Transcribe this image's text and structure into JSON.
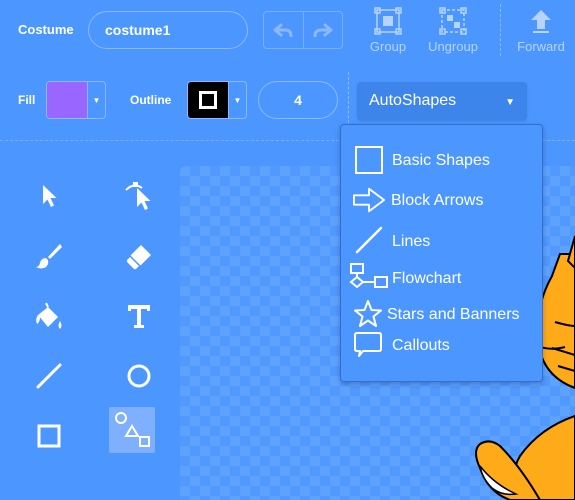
{
  "toolbar": {
    "costume_label": "Costume",
    "costume_name": "costume1",
    "group_label": "Group",
    "ungroup_label": "Ungroup",
    "forward_label": "Forward"
  },
  "style_row": {
    "fill_label": "Fill",
    "fill_color": "#9966ff",
    "outline_label": "Outline",
    "outline_color": "#000000",
    "outline_width": "4",
    "shape_select": "AutoShapes"
  },
  "autoshapes_menu": {
    "items": [
      {
        "label": "Basic Shapes",
        "icon": "square-outline-icon"
      },
      {
        "label": "Block Arrows",
        "icon": "block-arrow-icon"
      },
      {
        "label": "Lines",
        "icon": "line-icon"
      },
      {
        "label": "Flowchart",
        "icon": "flowchart-icon"
      },
      {
        "label": "Stars and Banners",
        "icon": "star-icon"
      },
      {
        "label": "Callouts",
        "icon": "callout-icon"
      }
    ]
  },
  "tools": [
    {
      "name": "select-tool",
      "icon": "arrow-pointer-icon"
    },
    {
      "name": "reshape-tool",
      "icon": "reshape-icon"
    },
    {
      "name": "brush-tool",
      "icon": "brush-icon"
    },
    {
      "name": "eraser-tool",
      "icon": "eraser-icon"
    },
    {
      "name": "fill-tool",
      "icon": "paint-bucket-icon"
    },
    {
      "name": "text-tool",
      "icon": "text-t-icon"
    },
    {
      "name": "line-tool",
      "icon": "line-icon"
    },
    {
      "name": "circle-tool",
      "icon": "circle-icon"
    },
    {
      "name": "rectangle-tool",
      "icon": "square-icon"
    },
    {
      "name": "autoshapes-tool",
      "icon": "shapes-icon",
      "selected": true
    }
  ],
  "colors": {
    "background": "#4c97ff",
    "selected_tool": "#7eb0ff",
    "cat_orange": "#ffab19"
  }
}
